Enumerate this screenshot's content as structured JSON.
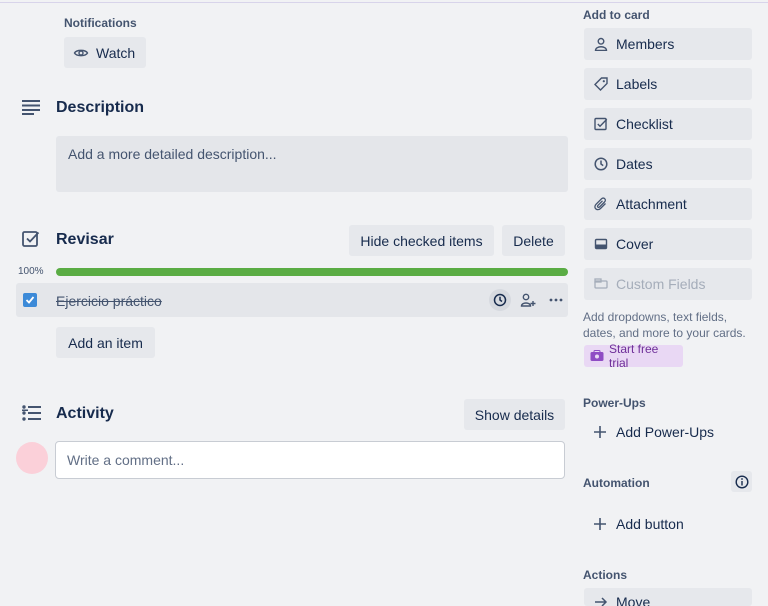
{
  "notifications": {
    "label": "Notifications",
    "watch_label": "Watch"
  },
  "description": {
    "heading": "Description",
    "placeholder": "Add a more detailed description..."
  },
  "checklist": {
    "heading": "Revisar",
    "hide_checked_label": "Hide checked items",
    "delete_label": "Delete",
    "progress_percent_label": "100%",
    "progress_fraction": 1.0,
    "items": [
      {
        "text": "Ejercicio práctico",
        "checked": true
      }
    ],
    "add_item_label": "Add an item"
  },
  "activity": {
    "heading": "Activity",
    "show_details_label": "Show details",
    "comment_placeholder": "Write a comment..."
  },
  "sidebar": {
    "add_to_card_label": "Add to card",
    "buttons": [
      {
        "label": "Members",
        "icon": "person-icon"
      },
      {
        "label": "Labels",
        "icon": "tag-icon"
      },
      {
        "label": "Checklist",
        "icon": "checklist-icon"
      },
      {
        "label": "Dates",
        "icon": "clock-icon"
      },
      {
        "label": "Attachment",
        "icon": "paperclip-icon"
      },
      {
        "label": "Cover",
        "icon": "cover-icon"
      },
      {
        "label": "Custom Fields",
        "icon": "custom-fields-icon"
      }
    ],
    "custom_fields_note": "Add dropdowns, text fields, dates, and more to your cards.",
    "start_trial_label": "Start free trial",
    "powerups_label": "Power-Ups",
    "add_powerups_label": "Add Power-Ups",
    "automation_label": "Automation",
    "add_button_label": "Add button",
    "actions_label": "Actions",
    "move_label": "Move"
  },
  "colors": {
    "progress": "#5aac44",
    "checkbox": "#3c8ad8",
    "trial_bg": "#e9d8f4",
    "avatar": "#fbd0d9"
  }
}
